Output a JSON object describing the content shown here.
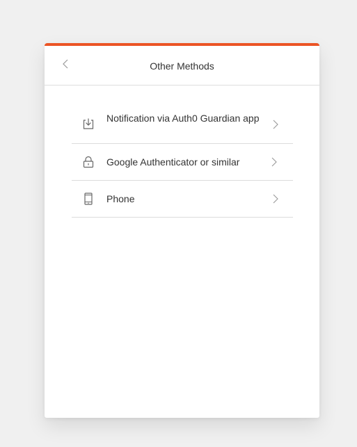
{
  "header": {
    "title": "Other Methods",
    "back_icon": "chevron-left-icon"
  },
  "methods": [
    {
      "label": "Notification via Auth0 Guardian app",
      "icon": "download-icon"
    },
    {
      "label": "Google Authenticator or similar",
      "icon": "lock-icon"
    },
    {
      "label": "Phone",
      "icon": "phone-icon"
    }
  ],
  "colors": {
    "accent": "#eb5424",
    "background": "#f0f0f0",
    "card": "#ffffff",
    "text": "#333333",
    "divider": "#dcdcdc",
    "icon": "#666666"
  }
}
